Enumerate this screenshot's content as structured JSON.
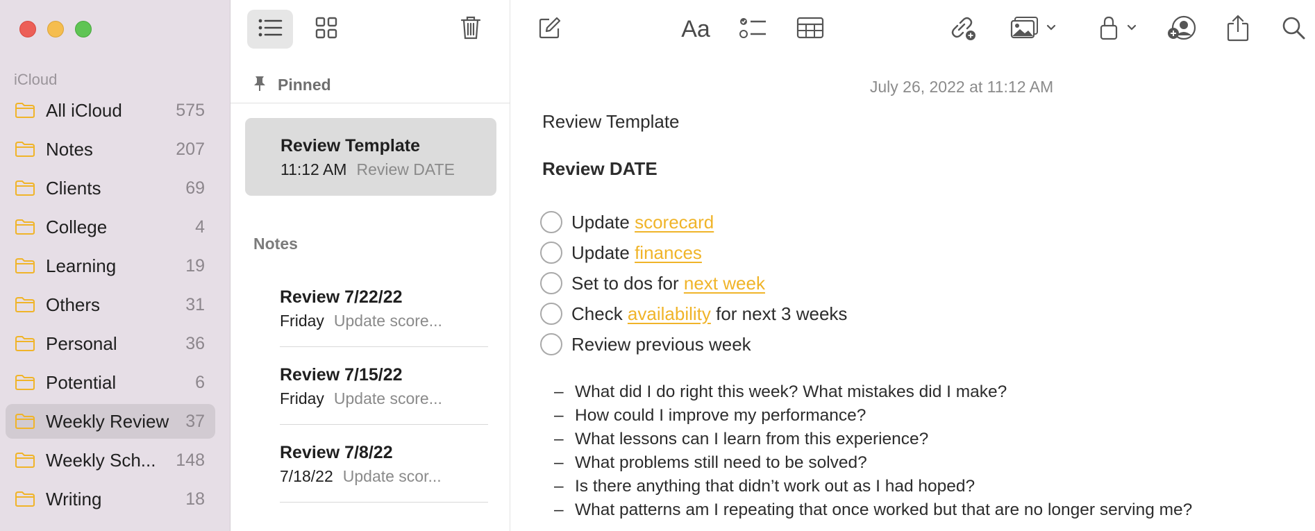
{
  "sidebar": {
    "section_label": "iCloud",
    "folders": [
      {
        "name": "All iCloud",
        "count": "575"
      },
      {
        "name": "Notes",
        "count": "207"
      },
      {
        "name": "Clients",
        "count": "69"
      },
      {
        "name": "College",
        "count": "4"
      },
      {
        "name": "Learning",
        "count": "19"
      },
      {
        "name": "Others",
        "count": "31"
      },
      {
        "name": "Personal",
        "count": "36"
      },
      {
        "name": "Potential",
        "count": "6"
      },
      {
        "name": "Weekly Review",
        "count": "37",
        "selected": true
      },
      {
        "name": "Weekly Sch...",
        "count": "148"
      },
      {
        "name": "Writing",
        "count": "18"
      }
    ],
    "folder_icon": "folder-icon",
    "accent_color": "#f0b429"
  },
  "note_list": {
    "toolbar": {
      "list_view_icon": "list-icon",
      "gallery_view_icon": "grid-icon",
      "delete_icon": "trash-icon"
    },
    "pinned_label": "Pinned",
    "pinned_note": {
      "title": "Review Template",
      "time": "11:12 AM",
      "preview": "Review DATE"
    },
    "notes_label": "Notes",
    "notes": [
      {
        "title": "Review 7/22/22",
        "time": "Friday",
        "preview": "Update score..."
      },
      {
        "title": "Review 7/15/22",
        "time": "Friday",
        "preview": "Update score..."
      },
      {
        "title": "Review 7/8/22",
        "time": "7/18/22",
        "preview": "Update scor..."
      }
    ]
  },
  "editor": {
    "toolbar": [
      "compose-icon",
      "text-format-icon",
      "checklist-icon",
      "table-icon",
      "link-icon",
      "media-icon",
      "lock-icon",
      "collaborate-icon",
      "share-icon",
      "search-icon"
    ],
    "format_label": "Aa",
    "date": "July 26, 2022 at 11:12 AM",
    "heading": "Review Template",
    "subheading": "Review DATE",
    "checklist": [
      {
        "before": "Update ",
        "link": "scorecard",
        "after": ""
      },
      {
        "before": "Update ",
        "link": "finances",
        "after": ""
      },
      {
        "before": "Set to dos for ",
        "link": "next week",
        "after": ""
      },
      {
        "before": "Check ",
        "link": "availability",
        "after": " for next 3 weeks"
      },
      {
        "before": "Review previous week",
        "link": "",
        "after": ""
      }
    ],
    "dash": "–",
    "questions": [
      "What did I do right this week? What mistakes did I make?",
      "How could I improve my performance?",
      "What lessons can I learn from this experience?",
      "What problems still need to be solved?",
      "Is there anything that didn’t work out as I had hoped?",
      "What patterns am I repeating that once worked but that are no longer serving me?"
    ]
  }
}
